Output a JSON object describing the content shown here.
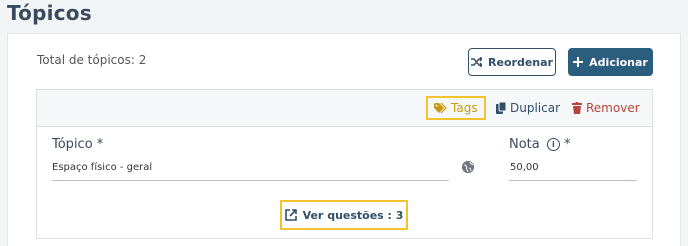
{
  "page": {
    "title": "Tópicos"
  },
  "summary": {
    "total_label": "Total de tópicos: 2"
  },
  "toolbar": {
    "reorder_label": "Reordenar",
    "add_label": "Adicionar"
  },
  "topic": {
    "actions": {
      "tags": "Tags",
      "duplicate": "Duplicar",
      "remove": "Remover"
    },
    "topic_label": "Tópico *",
    "topic_value": "Espaço físico - geral",
    "grade_label": "Nota",
    "grade_required": "*",
    "grade_value": "50,00",
    "questions_button": "Ver questões : 3"
  },
  "icons": {
    "reorder": "shuffle-icon",
    "add": "plus-icon",
    "tags": "tags-icon",
    "duplicate": "copy-icon",
    "remove": "trash-icon",
    "info": "info-icon",
    "globe": "globe-icon",
    "questions": "external-link-icon"
  },
  "colors": {
    "primary": "#2b5d7e",
    "highlight": "#f2c230",
    "danger": "#b5453d",
    "tag": "#c79b16"
  }
}
